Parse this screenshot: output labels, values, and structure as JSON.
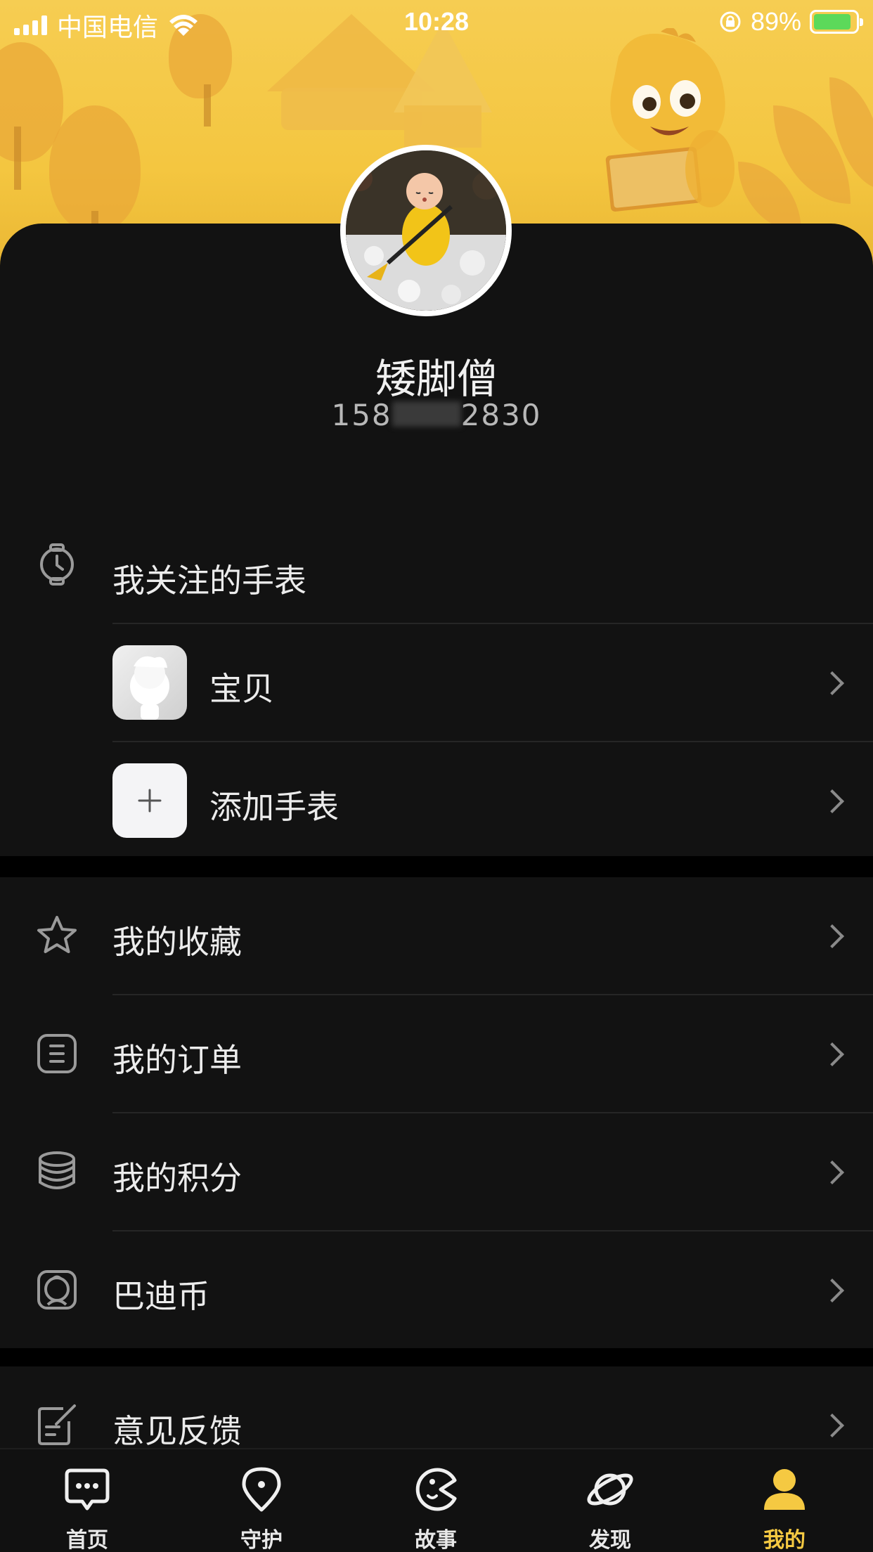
{
  "status_bar": {
    "carrier": "中国电信",
    "time": "10:28",
    "battery_percent": "89%",
    "battery_level": 0.89
  },
  "profile": {
    "name": "矮脚僧",
    "phone_prefix": "158",
    "phone_suffix": "2830"
  },
  "watch_section": {
    "title": "我关注的手表",
    "items": [
      {
        "label": "宝贝",
        "icon": "baby-avatar-icon"
      },
      {
        "label": "添加手表",
        "icon": "plus-icon"
      }
    ]
  },
  "menu": [
    {
      "label": "我的收藏",
      "icon": "star-icon"
    },
    {
      "label": "我的订单",
      "icon": "order-list-icon"
    },
    {
      "label": "我的积分",
      "icon": "coin-stack-icon"
    },
    {
      "label": "巴迪币",
      "icon": "badi-coin-icon"
    }
  ],
  "menu2": [
    {
      "label": "意见反馈",
      "icon": "feedback-icon"
    }
  ],
  "tabs": [
    {
      "label": "首页",
      "icon": "chat-bubble-icon",
      "active": false
    },
    {
      "label": "守护",
      "icon": "location-pin-icon",
      "active": false
    },
    {
      "label": "故事",
      "icon": "pacman-icon",
      "active": false
    },
    {
      "label": "发现",
      "icon": "planet-icon",
      "active": false
    },
    {
      "label": "我的",
      "icon": "person-icon",
      "active": true
    }
  ],
  "colors": {
    "accent": "#f5c942",
    "banner": "#f4c640",
    "background": "#121212",
    "separator": "#000000"
  }
}
